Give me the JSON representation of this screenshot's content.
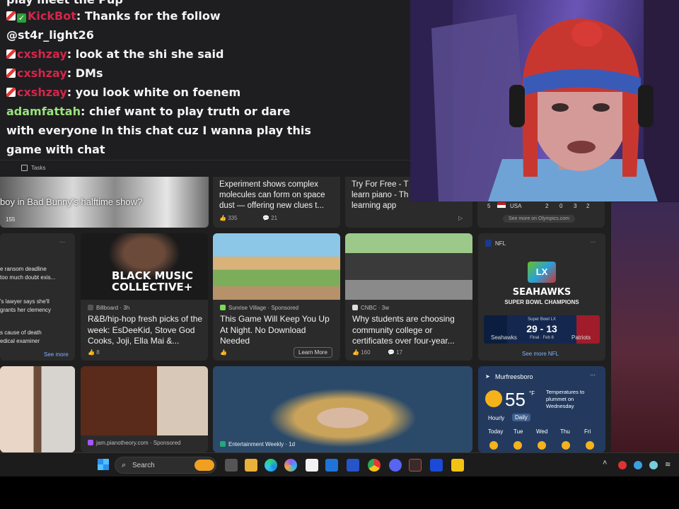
{
  "chat": {
    "messages": [
      {
        "user": "KickBot",
        "text": "Thanks for the follow"
      },
      {
        "user": "",
        "text": "@st4r_light26"
      },
      {
        "user": "cxshzay",
        "text": "look at the shi she said"
      },
      {
        "user": "cxshzay",
        "text": "DMs"
      },
      {
        "user": "cxshzay",
        "text": "you look white on foenem"
      },
      {
        "user": "adamfattah",
        "text": "chief want to play truth or dare"
      },
      {
        "user": "",
        "text": "with everyone In this chat cuz I wanna play this"
      },
      {
        "user": "",
        "text": "game with chat"
      }
    ],
    "partial_top": "play meet the Pup",
    "bottom_tab": "Tasks",
    "colors": {
      "name_red": "#d3264a",
      "name_green": "#9be27c"
    }
  },
  "feed": {
    "row1": [
      {
        "title": "boy in Bad Bunny's halftime show?",
        "count": "155"
      },
      {
        "title": "Experiment shows complex molecules can form on space dust — offering new clues t...",
        "likes": "335",
        "comments": "21"
      },
      {
        "title": "Try For Free - T learn piano - Th learning app"
      },
      {
        "medal_rank": "5",
        "country": "USA",
        "medals": [
          "2",
          "0",
          "3",
          "2"
        ],
        "link": "See more on Olympics.com"
      }
    ],
    "row2": {
      "ransom": {
        "lines": [
          "e ransom deadline",
          "too much doubt exis...",
          "'s lawyer says she'll",
          "grants her clemency",
          "s cause of death",
          "edical examiner"
        ],
        "see_more": "See more"
      },
      "billboard": {
        "image_text": "BLACK MUSIC COLLECTIVE+",
        "source": "Billboard · 3h",
        "title": "R&B/hip-hop fresh picks of the week: EsDeeKid, Stove God Cooks, Joji, Ella Mai &...",
        "likes": "8"
      },
      "game": {
        "source": "Sunrise Village · Sponsored",
        "title": "This Game Will Keep You Up At Night. No Download Needed",
        "button": "Learn More"
      },
      "cnbc": {
        "source": "CNBC · 3w",
        "title": "Why students are choosing community college or certificates over four-year...",
        "likes": "160",
        "comments": "17"
      },
      "nfl": {
        "league": "NFL",
        "logo_text": "LX",
        "headline": "SEAHAWKS",
        "subhead": "SUPER BOWL CHAMPIONS",
        "game_label": "Super Bowl LX",
        "status": "Final · Feb 8",
        "score": "29 - 13",
        "team_home": "Seahawks",
        "team_away": "Patriots",
        "link": "See more NFL"
      }
    },
    "row3": {
      "entertainment_source": "Entertainment Weekly · 1d",
      "piano_source": "jam.pianotheory.com · Sponsored",
      "weather": {
        "city": "Murfreesboro",
        "temp": "55",
        "unit": "°F",
        "note": "Temperatures to plummet on Wednesday",
        "tabs": [
          "Hourly",
          "Daily"
        ],
        "days": [
          "Today",
          "Tue",
          "Wed",
          "Thu",
          "Fri"
        ]
      }
    }
  },
  "taskbar": {
    "search_placeholder": "Search"
  },
  "colors": {
    "feed_bg": "#1f1f1f",
    "card_bg": "#2b2b2b",
    "taskbar": "#1c1c1c",
    "seahawks_navy": "#0b1e3f",
    "seahawks_green": "#69be28"
  }
}
